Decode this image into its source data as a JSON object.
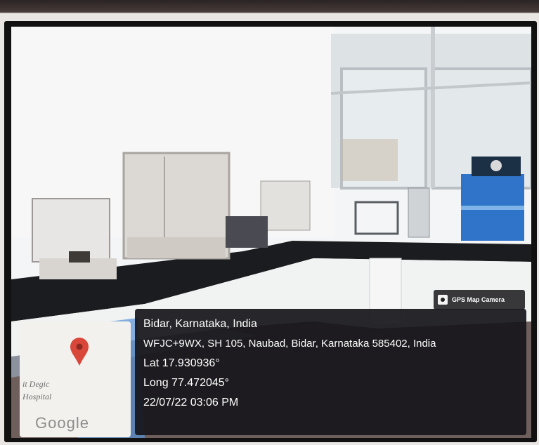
{
  "gps_badge": {
    "label": "GPS Map Camera"
  },
  "map_thumb": {
    "place_label_1": "it Degic",
    "place_label_2": "Hospital",
    "logo_text": "Google"
  },
  "location": {
    "city": "Bidar, Karnataka, India",
    "address": "WFJC+9WX, SH 105, Naubad, Bidar, Karnataka 585402, India",
    "lat": "Lat 17.930936°",
    "long": "Long 77.472045°",
    "datetime": "22/07/22 03:06 PM"
  },
  "icons": {
    "camera": "camera-icon",
    "pin": "map-pin-icon"
  },
  "colors": {
    "overlay_bg": "#16161a",
    "pin_red": "#d9473a",
    "equipment_blue": "#2f74c8"
  }
}
